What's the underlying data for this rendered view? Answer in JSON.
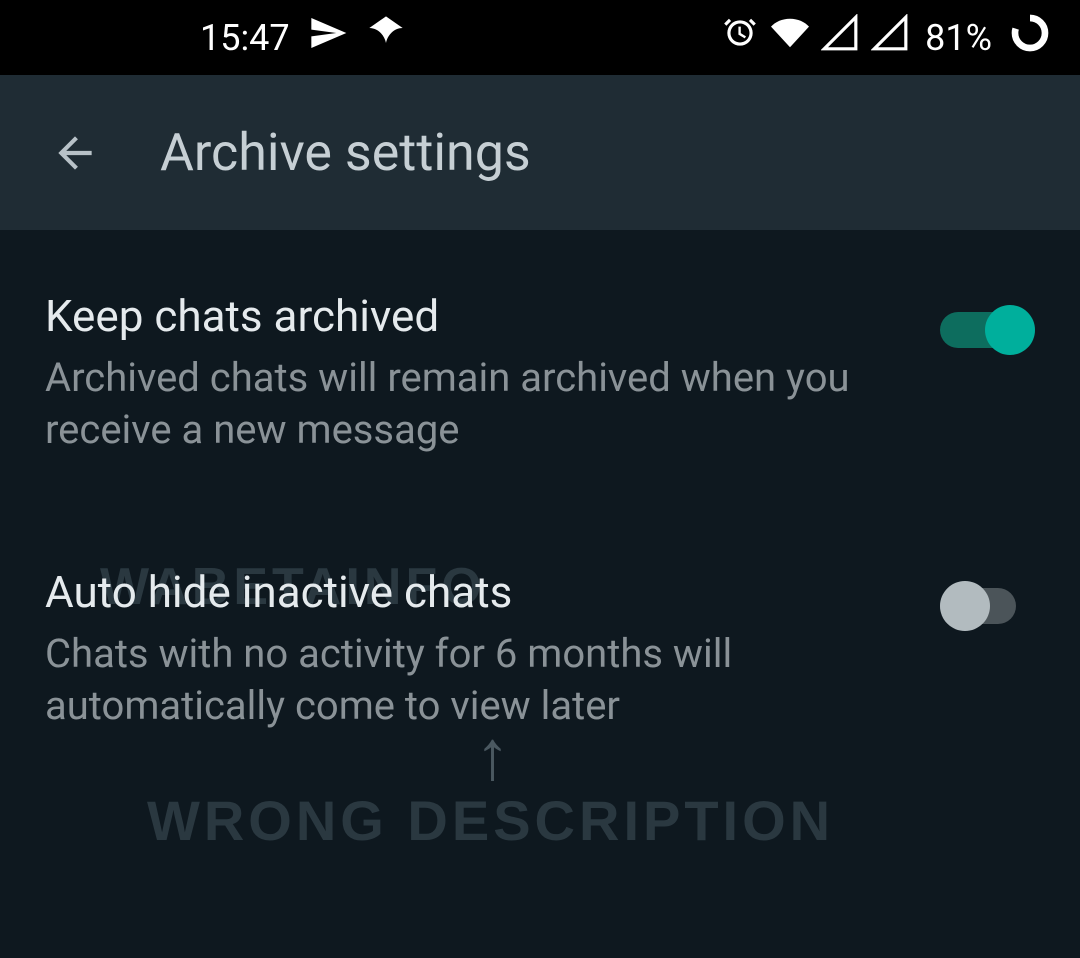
{
  "statusBar": {
    "time": "15:47",
    "battery": "81%"
  },
  "appBar": {
    "title": "Archive settings"
  },
  "settings": {
    "item1": {
      "title": "Keep chats archived",
      "description": "Archived chats will remain archived when you receive a new message",
      "enabled": true
    },
    "item2": {
      "title": "Auto hide inactive chats",
      "description": "Chats with no activity for 6 months will automatically come to view later",
      "enabled": false
    }
  },
  "watermarks": {
    "w1": "WABETAINFO",
    "w2": "WRONG DESCRIPTION"
  }
}
